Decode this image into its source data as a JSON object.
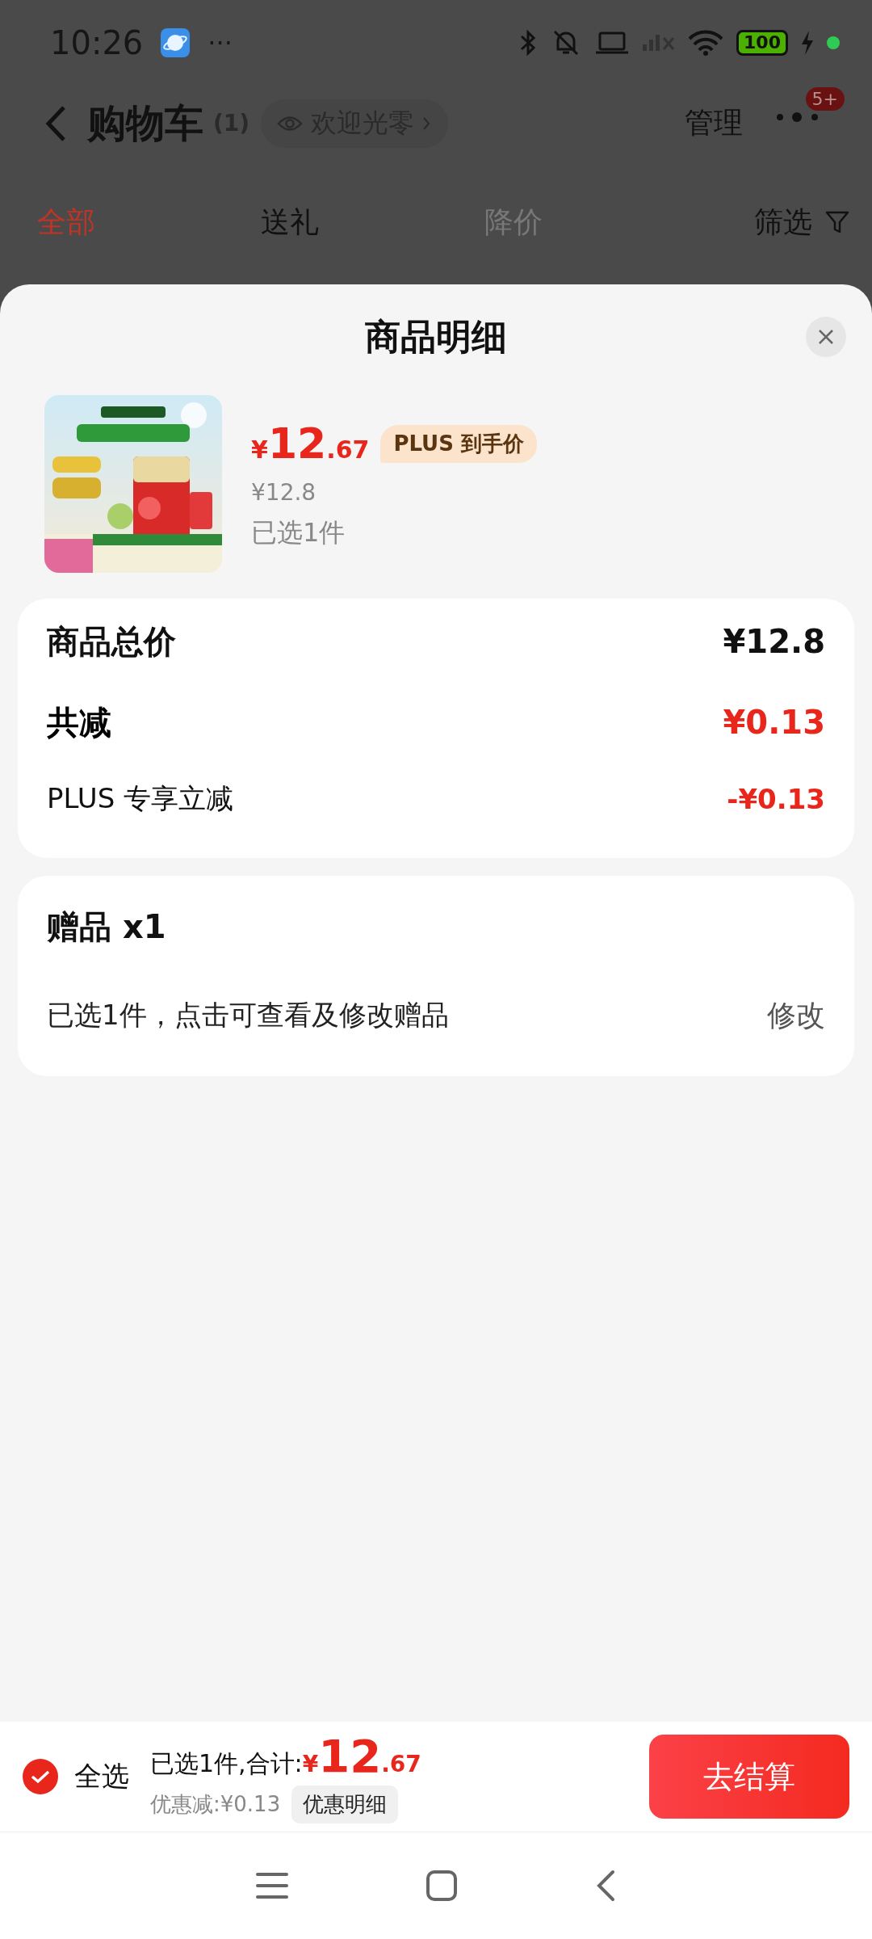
{
  "status_bar": {
    "time": "10:26",
    "more": "···",
    "battery": "100"
  },
  "header": {
    "title": "购物车",
    "count": "(1)",
    "welcome": "欢迎光零",
    "manage": "管理",
    "badge": "5+"
  },
  "tabs": [
    {
      "label": "全部",
      "selected": true,
      "disabled": false
    },
    {
      "label": "送礼",
      "selected": false,
      "disabled": false
    },
    {
      "label": "降价",
      "selected": false,
      "disabled": true
    }
  ],
  "filter": "筛选",
  "sheet": {
    "title": "商品明细",
    "product": {
      "currency": "¥",
      "price_int": "12",
      "price_dec": ".67",
      "plus_tag": "PLUS 到手价",
      "original_price": "¥12.8",
      "selected_count": "已选1件"
    },
    "summary": [
      {
        "label": "商品总价",
        "value": "¥12.8",
        "kind": "total"
      },
      {
        "label": "共减",
        "value": "¥0.13",
        "kind": "discount"
      },
      {
        "label": "PLUS 专享立减",
        "value": "-¥0.13",
        "kind": "detail"
      }
    ],
    "gift": {
      "title": "赠品 x1",
      "description": "已选1件，点击可查看及修改赠品",
      "action": "修改"
    }
  },
  "bottom_bar": {
    "select_all": {
      "label": "全选",
      "checked": true
    },
    "selected_total": "已选1件,合计:",
    "currency": "¥",
    "total_int": "12",
    "total_dec": ".67",
    "saving": "优惠减:¥0.13",
    "detail_button": "优惠明细",
    "checkout": "去结算"
  }
}
